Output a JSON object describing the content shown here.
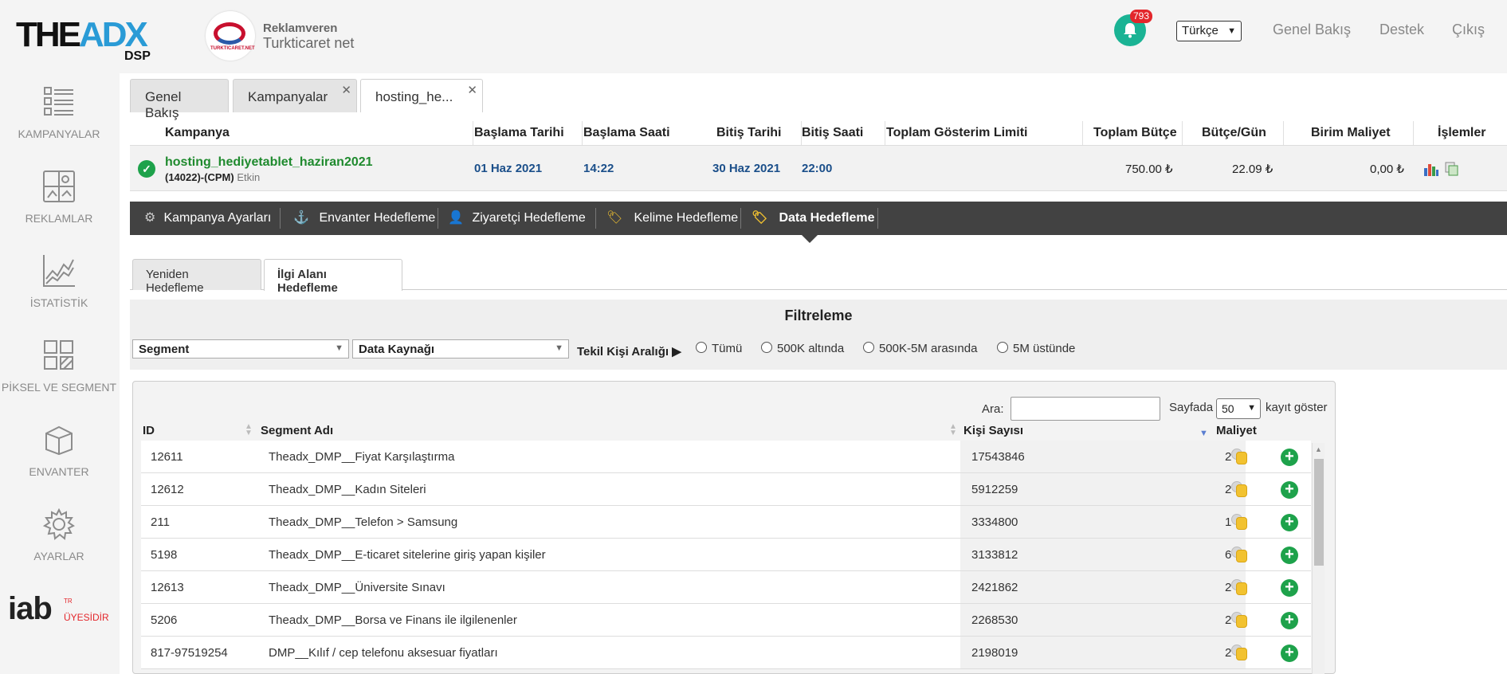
{
  "brand": {
    "logo_main": "THE",
    "logo_accent": "ADX",
    "logo_sub": "DSP"
  },
  "advertiser": {
    "role": "Reklamveren",
    "name": "Turkticaret net",
    "logo_text": "TURKTICARET.NET"
  },
  "header": {
    "notifications": "793",
    "language": "Türkçe",
    "links": [
      "Genel Bakış",
      "Destek",
      "Çıkış"
    ]
  },
  "sidebar": {
    "items": [
      {
        "label": "KAMPANYALAR",
        "icon": "list-icon"
      },
      {
        "label": "REKLAMLAR",
        "icon": "ads-icon"
      },
      {
        "label": "İSTATİSTİK",
        "icon": "chart-icon"
      },
      {
        "label": "PİKSEL VE SEGMENT",
        "icon": "pixel-icon"
      },
      {
        "label": "ENVANTER",
        "icon": "box-icon"
      },
      {
        "label": "AYARLAR",
        "icon": "gear-icon"
      }
    ],
    "iab": {
      "text": "iab",
      "tr": "TR",
      "member": "ÜYESİDİR"
    }
  },
  "tabs": [
    {
      "label": "Genel Bakış",
      "closable": false
    },
    {
      "label": "Kampanyalar",
      "closable": true
    },
    {
      "label": "hosting_he...",
      "closable": true
    }
  ],
  "campaign_table": {
    "headers": [
      "Kampanya",
      "Başlama Tarihi",
      "Başlama Saati",
      "Bitiş Tarihi",
      "Bitiş Saati",
      "Toplam Gösterim Limiti",
      "Toplam Bütçe",
      "Bütçe/Gün",
      "Birim Maliyet",
      "İşlemler"
    ],
    "row": {
      "name": "hosting_hediyetablet_haziran2021",
      "id_type": "(14022)-(CPM)",
      "status": "Etkin",
      "start_date": "01 Haz 2021",
      "start_time": "14:22",
      "end_date": "30 Haz 2021",
      "end_time": "22:00",
      "impression_limit": "",
      "total_budget": "750.00 ₺",
      "daily_budget": "22.09 ₺",
      "unit_cost": "0,00 ₺"
    }
  },
  "dark_nav": [
    "Kampanya Ayarları",
    "Envanter Hedefleme",
    "Ziyaretçi Hedefleme",
    "Kelime Hedefleme",
    "Data Hedefleme"
  ],
  "sub_tabs": [
    "Yeniden Hedefleme",
    "İlgi Alanı Hedefleme"
  ],
  "filter": {
    "title": "Filtreleme",
    "segment_placeholder": "Segment",
    "source_placeholder": "Data Kaynağı",
    "range_label": "Tekil Kişi Aralığı ▶",
    "options": [
      "Tümü",
      "500K altında",
      "500K-5M arasında",
      "5M üstünde"
    ]
  },
  "segment_table": {
    "search_label": "Ara:",
    "page_label": "Sayfada",
    "page_size": "50",
    "page_label2": "kayıt göster",
    "headers": {
      "id": "ID",
      "name": "Segment Adı",
      "count": "Kişi Sayısı",
      "cost": "Maliyet"
    },
    "rows": [
      {
        "id": "12611",
        "name": "Theadx_DMP__Fiyat Karşılaştırma",
        "count": "17543846",
        "cost": "2"
      },
      {
        "id": "12612",
        "name": "Theadx_DMP__Kadın Siteleri",
        "count": "5912259",
        "cost": "2"
      },
      {
        "id": "211",
        "name": "Theadx_DMP__Telefon > Samsung",
        "count": "3334800",
        "cost": "1"
      },
      {
        "id": "5198",
        "name": "Theadx_DMP__E-ticaret sitelerine giriş yapan kişiler",
        "count": "3133812",
        "cost": "6"
      },
      {
        "id": "12613",
        "name": "Theadx_DMP__Üniversite Sınavı",
        "count": "2421862",
        "cost": "2"
      },
      {
        "id": "5206",
        "name": "Theadx_DMP__Borsa ve Finans ile ilgilenenler",
        "count": "2268530",
        "cost": "2"
      },
      {
        "id": "817-97519254",
        "name": "DMP__Kılıf / cep telefonu aksesuar fiyatları",
        "count": "2198019",
        "cost": "2"
      }
    ]
  }
}
